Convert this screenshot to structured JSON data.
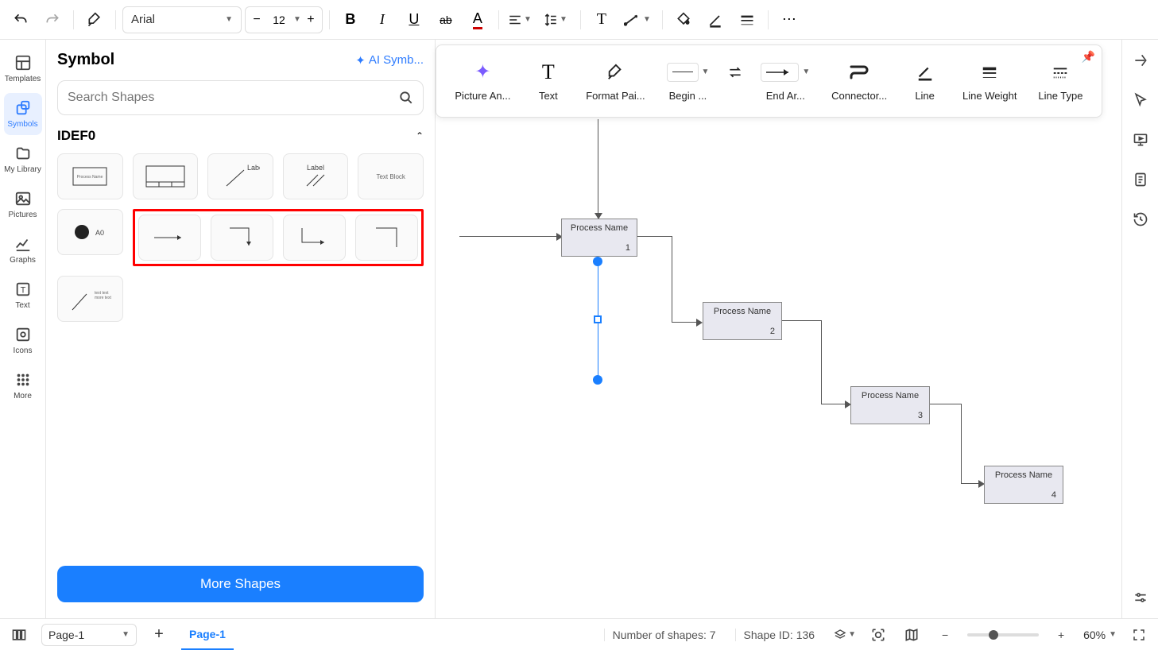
{
  "toolbar": {
    "font": "Arial",
    "fontSize": "12"
  },
  "panel": {
    "title": "Symbol",
    "aiLabel": "AI Symb...",
    "searchPlaceholder": "Search Shapes",
    "category": "IDEF0",
    "shapes": {
      "s1": "Process Name",
      "s3": "Label",
      "s4": "Label",
      "s5": "Text Block",
      "s6": "A0"
    },
    "moreShapes": "More Shapes"
  },
  "leftRail": {
    "templates": "Templates",
    "symbols": "Symbols",
    "myLibrary": "My Library",
    "pictures": "Pictures",
    "graphs": "Graphs",
    "text": "Text",
    "icons": "Icons",
    "more": "More"
  },
  "contextToolbar": {
    "pictureAn": "Picture An...",
    "text": "Text",
    "formatPai": "Format Pai...",
    "begin": "Begin ...",
    "endAr": "End Ar...",
    "connector": "Connector...",
    "line": "Line",
    "lineWeight": "Line Weight",
    "lineType": "Line Type"
  },
  "canvas": {
    "p1": {
      "name": "Process Name",
      "num": "1"
    },
    "p2": {
      "name": "Process Name",
      "num": "2"
    },
    "p3": {
      "name": "Process Name",
      "num": "3"
    },
    "p4": {
      "name": "Process Name",
      "num": "4"
    }
  },
  "bottomBar": {
    "pageSel": "Page-1",
    "pageTab": "Page-1",
    "shapeCount": "Number of shapes: 7",
    "shapeId": "Shape ID: 136",
    "zoom": "60%"
  }
}
